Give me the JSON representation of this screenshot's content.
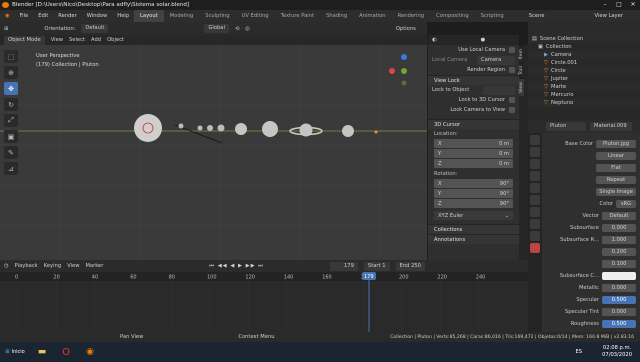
{
  "window": {
    "title": "Blender [D:\\Users\\Nico\\Desktop\\Para adfly\\Sistema solar.blend]"
  },
  "menu": [
    "File",
    "Edit",
    "Render",
    "Window",
    "Help"
  ],
  "workspaces": [
    "Layout",
    "Modeling",
    "Sculpting",
    "UV Editing",
    "Texture Paint",
    "Shading",
    "Animation",
    "Rendering",
    "Compositing",
    "Scripting"
  ],
  "scene": {
    "label": "Scene",
    "view_layer": "View Layer"
  },
  "header": {
    "orientation_label": "Orientation:",
    "orientation_value": "Default",
    "transform": "Global",
    "mode": "Object Mode",
    "menus": [
      "View",
      "Select",
      "Add",
      "Object"
    ],
    "options": "Options"
  },
  "viewport": {
    "line1": "User Perspective",
    "line2": "(179) Collection | Pluton"
  },
  "npanel": {
    "use_local_camera": "Use Local Camera",
    "local_camera_label": "Local Camera",
    "local_camera_value": "Camera",
    "render_region": "Render Region",
    "view_lock": "View Lock",
    "lock_to_object": "Lock to Object",
    "lock_3d_cursor": "Lock to 3D Cursor",
    "lock_camera": "Lock Camera to View",
    "cursor_section": "3D Cursor",
    "location": "Location:",
    "loc": [
      {
        "axis": "X",
        "val": "0 m"
      },
      {
        "axis": "Y",
        "val": "0 m"
      },
      {
        "axis": "Z",
        "val": "0 m"
      }
    ],
    "rotation": "Rotation:",
    "rot": [
      {
        "axis": "X",
        "val": "90°"
      },
      {
        "axis": "Y",
        "val": "90°"
      },
      {
        "axis": "Z",
        "val": "90°"
      }
    ],
    "rot_mode": "XYZ Euler",
    "collections": "Collections",
    "annotations": "Annotations",
    "tabs": [
      "Item",
      "Tool",
      "View"
    ]
  },
  "timeline": {
    "menus": [
      "Playback",
      "Keying",
      "View",
      "Marker"
    ],
    "current": "179",
    "start_label": "Start",
    "start": "1",
    "end_label": "End",
    "end": "250",
    "ticks": [
      "0",
      "20",
      "40",
      "60",
      "80",
      "100",
      "120",
      "140",
      "160",
      "180",
      "200",
      "220",
      "240"
    ],
    "playhead": "179"
  },
  "outliner": {
    "title": "Scene Collection",
    "items": [
      "Collection",
      "Camera",
      "Circle.001",
      "Circle",
      "Jupiter",
      "Marte",
      "Mercurio",
      "Neptuno"
    ]
  },
  "properties": {
    "object": "Pluton",
    "material": "Material.009",
    "base_color_label": "Base Color",
    "base_color_value": "Pluton.jpg",
    "interp": "Linear",
    "proj": "Flat",
    "ext": "Repeat",
    "source": "Single Image",
    "color_label": "Color",
    "color_space": "sRG",
    "vector_label": "Vector",
    "vector_value": "Default",
    "rows": [
      {
        "label": "Subsurface",
        "value": "0.000",
        "style": ""
      },
      {
        "label": "Subsurface R...",
        "value": "1.000",
        "style": ""
      },
      {
        "label": "",
        "value": "0.200",
        "style": ""
      },
      {
        "label": "",
        "value": "0.100",
        "style": ""
      },
      {
        "label": "Subsurface C...",
        "value": "",
        "style": "white"
      },
      {
        "label": "Metallic",
        "value": "0.000",
        "style": ""
      },
      {
        "label": "Specular",
        "value": "0.500",
        "style": "blue"
      },
      {
        "label": "Specular Tint",
        "value": "0.000",
        "style": ""
      },
      {
        "label": "Roughness",
        "value": "0.500",
        "style": "blue"
      }
    ]
  },
  "status": {
    "left": "Pan View",
    "mid": "Context Menu",
    "right": "Collection | Pluton | Verts:85,268 | Caras:86,016 | Tris:169,472 | Objetos:0/14 | Mem: 160.8 MiB | v2.83.16"
  },
  "taskbar": {
    "start": "Inicio",
    "lang": "ES",
    "time": "02:08 p.m.",
    "date": "07/03/2020"
  }
}
